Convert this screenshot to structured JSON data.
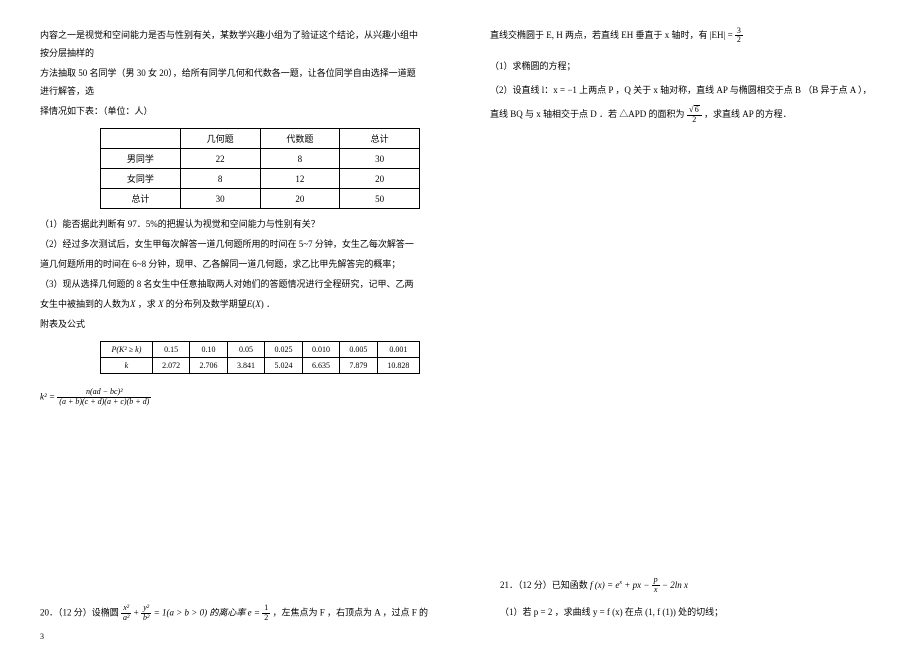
{
  "left": {
    "intro_1": "内容之一是视觉和空间能力是否与性别有关，某数学兴趣小组为了验证这个结论，从兴趣小组中按分层抽样的",
    "intro_2": "方法抽取 50 名同学（男 30 女 20），给所有同学几何和代数各一题，让各位同学自由选择一道题进行解答，选",
    "intro_3": "择情况如下表：（单位：人）",
    "table1": {
      "headers": [
        "",
        "几何题",
        "代数题",
        "总计"
      ],
      "rows": [
        [
          "男同学",
          "22",
          "8",
          "30"
        ],
        [
          "女同学",
          "8",
          "12",
          "20"
        ],
        [
          "总计",
          "30",
          "20",
          "50"
        ]
      ]
    },
    "q1": "（1）能否据此判断有 97．5%的把握认为视觉和空间能力与性别有关？",
    "q2_1": "（2）经过多次测试后，女生甲每次解答一道几何题所用的时间在 5~7 分钟，女生乙每次解答一",
    "q2_2": "道几何题所用的时间在 6~8 分钟，现甲、乙各解同一道几何题，求乙比甲先解答完的概率；",
    "q3_1": "（3）现从选择几何题的 8 名女生中任意抽取两人对她们的答题情况进行全程研究，记甲、乙两",
    "q3_2_a": "女生中被抽到的人数为",
    "q3_2_b": "X",
    "q3_2_c": " ，求 ",
    "q3_2_d": "X",
    "q3_2_e": " 的分布列及数学期望",
    "q3_2_f": "E",
    "q3_2_g": "(",
    "q3_2_h": "X",
    "q3_2_i": ") ．",
    "appendix": "附表及公式",
    "table2": {
      "row1": [
        "P(K² ≥ k)",
        "0.15",
        "0.10",
        "0.05",
        "0.025",
        "0.010",
        "0.005",
        "0.001"
      ],
      "row2": [
        "k",
        "2.072",
        "2.706",
        "3.841",
        "5.024",
        "6.635",
        "7.879",
        "10.828"
      ]
    },
    "formula": {
      "lhs": "k² =",
      "num": "n(ad − bc)²",
      "den": "(a + b)(c + d)(a + c)(b + d)"
    },
    "q20": {
      "prefix": "20．（12 分）设椭圆",
      "eq_num_a": "x²",
      "eq_den_a": "a²",
      "plus": " + ",
      "eq_num_b": "y²",
      "eq_den_b": "b²",
      "mid": " = 1(a > b > 0) 的离心率 e = ",
      "e_num": "1",
      "e_den": "2",
      "tail": " ，左焦点为 F ，右顶点为 A ，过点 F 的"
    }
  },
  "right": {
    "line1_a": "直线交椭圆于 E, H 两点，若直线 EH 垂直于 x 轴时，有 |EH| = ",
    "line1_num": "3",
    "line1_den": "2",
    "q1": "（1）求椭圆的方程；",
    "q2_1": "（2）设直线 l：x = −1 上两点 P ，Q 关于 x 轴对称，直线 AP 与椭圆相交于点 B （B 异于点 A ），",
    "q2_2_a": "直线 BQ 与 x 轴相交于点 D ．若 △APD 的面积为 ",
    "q2_2_num": "6",
    "q2_2_den": "2",
    "q2_2_b": " ，求直线 AP 的方程．",
    "q21": {
      "prefix": "21．（12 分）已知函数 ",
      "fx": "f (x) = e",
      "sup": "x",
      "mid": " + px − ",
      "p_num": "p",
      "p_den": "x",
      "tail": " − 2ln x"
    },
    "q21_sub": "（1）若 p = 2 ，求曲线 y = f (x) 在点 (1, f (1)) 处的切线；"
  },
  "page_number": "3"
}
